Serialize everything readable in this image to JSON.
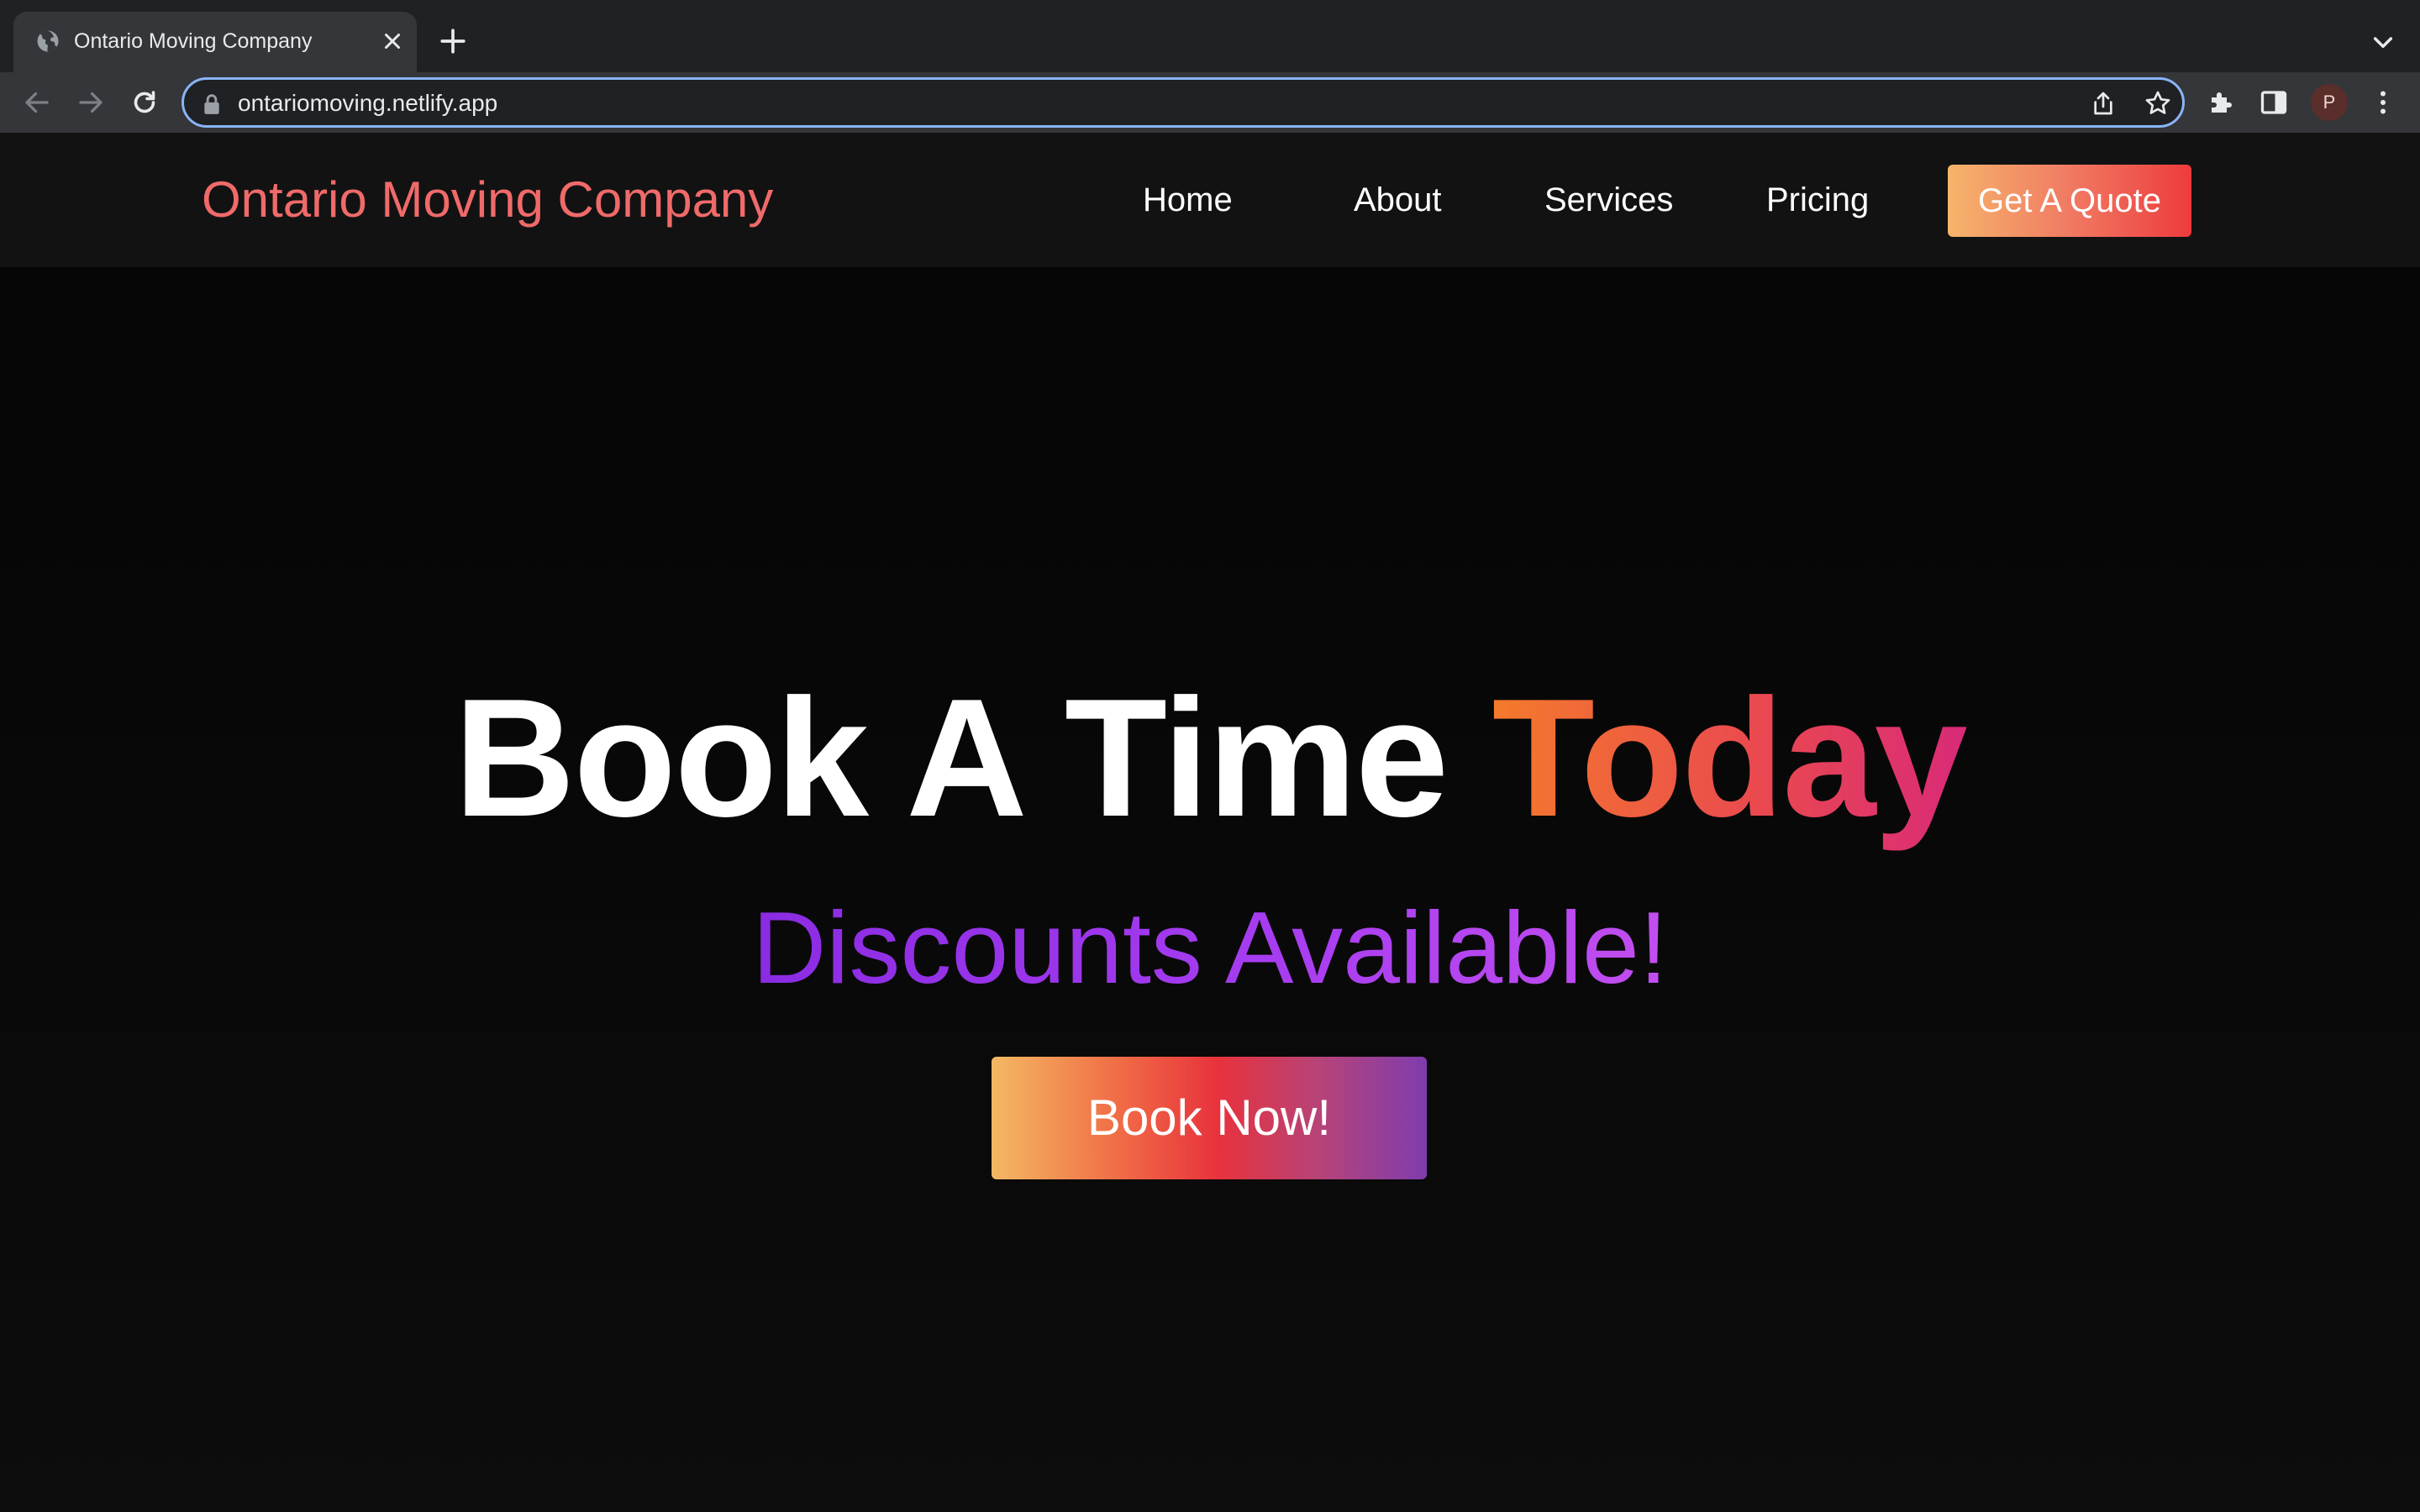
{
  "browser": {
    "tab_title": "Ontario Moving Company",
    "url": "ontariomoving.netlify.app",
    "profile_initial": "P"
  },
  "site": {
    "logo": "Ontario Moving Company",
    "nav": {
      "home": "Home",
      "about": "About",
      "services": "Services",
      "pricing": "Pricing"
    },
    "cta": "Get A Quote"
  },
  "hero": {
    "title_main": "Book A Time",
    "title_accent": "Today",
    "subtitle": "Discounts Available!",
    "button": "Book Now!"
  },
  "colors": {
    "logo": "#f06a6a",
    "accent_orange": "#f47a2c",
    "accent_pink": "#d92a78",
    "subtitle_purple": "#8a2be2",
    "omnibox_focus": "#8ab4f8"
  }
}
